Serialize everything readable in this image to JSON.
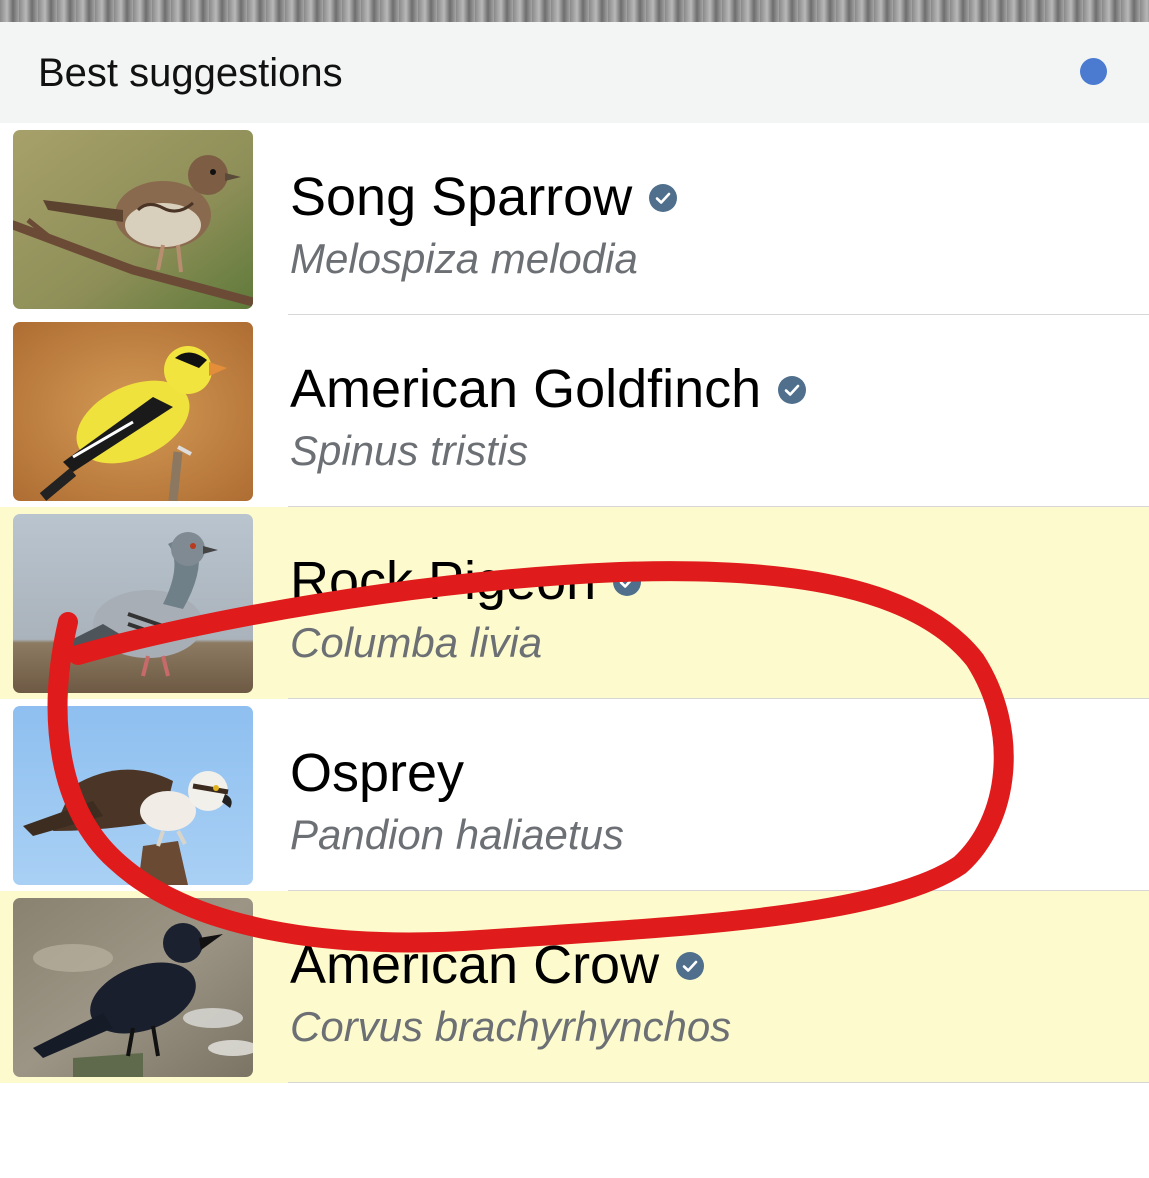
{
  "header": {
    "title": "Best suggestions",
    "status_dot_color": "#4a7bd0"
  },
  "suggestions": [
    {
      "common_name": "Song Sparrow",
      "scientific_name": "Melospiza melodia",
      "verified": true,
      "highlighted": false,
      "thumbnail_icon": "song-sparrow-photo"
    },
    {
      "common_name": "American Goldfinch",
      "scientific_name": "Spinus tristis",
      "verified": true,
      "highlighted": false,
      "thumbnail_icon": "american-goldfinch-photo"
    },
    {
      "common_name": "Rock Pigeon",
      "scientific_name": "Columba livia",
      "verified": true,
      "highlighted": true,
      "thumbnail_icon": "rock-pigeon-photo"
    },
    {
      "common_name": "Osprey",
      "scientific_name": "Pandion haliaetus",
      "verified": false,
      "highlighted": false,
      "thumbnail_icon": "osprey-photo"
    },
    {
      "common_name": "American Crow",
      "scientific_name": "Corvus brachyrhynchos",
      "verified": true,
      "highlighted": true,
      "thumbnail_icon": "american-crow-photo"
    }
  ],
  "colors": {
    "highlight_row": "#fdfbcd",
    "verified_badge": "#4f6f8c",
    "annotation_stroke": "#e01b1b"
  }
}
